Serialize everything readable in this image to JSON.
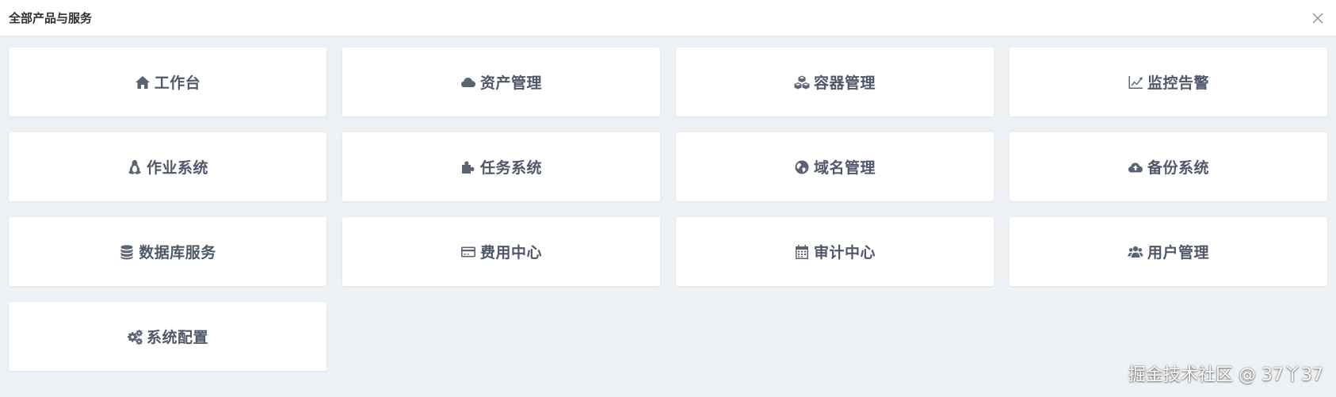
{
  "header": {
    "title": "全部产品与服务",
    "close_icon": "close-icon"
  },
  "colors": {
    "background": "#eef1f4",
    "card": "#ffffff",
    "text": "#4f5869",
    "icon": "#5a6475"
  },
  "cards": [
    {
      "label": "工作台",
      "icon": "home-icon"
    },
    {
      "label": "资产管理",
      "icon": "cloud-icon"
    },
    {
      "label": "容器管理",
      "icon": "cubes-icon"
    },
    {
      "label": "监控告警",
      "icon": "line-chart-icon"
    },
    {
      "label": "作业系统",
      "icon": "linux-icon"
    },
    {
      "label": "任务系统",
      "icon": "puzzle-icon"
    },
    {
      "label": "域名管理",
      "icon": "globe-icon"
    },
    {
      "label": "备份系统",
      "icon": "cloud-upload-icon"
    },
    {
      "label": "数据库服务",
      "icon": "database-icon"
    },
    {
      "label": "费用中心",
      "icon": "credit-card-icon"
    },
    {
      "label": "审计中心",
      "icon": "calendar-icon"
    },
    {
      "label": "用户管理",
      "icon": "users-icon"
    },
    {
      "label": "系统配置",
      "icon": "cogs-icon"
    }
  ],
  "watermark": "掘金技术社区 @ 37丫37"
}
